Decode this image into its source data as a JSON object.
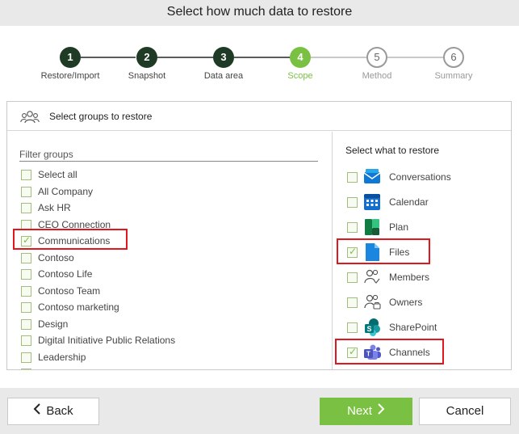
{
  "header": {
    "title": "Select how much data to restore"
  },
  "steps": [
    {
      "num": "1",
      "label": "Restore/Import",
      "state": "done"
    },
    {
      "num": "2",
      "label": "Snapshot",
      "state": "done"
    },
    {
      "num": "3",
      "label": "Data area",
      "state": "done"
    },
    {
      "num": "4",
      "label": "Scope",
      "state": "active"
    },
    {
      "num": "5",
      "label": "Method",
      "state": "todo"
    },
    {
      "num": "6",
      "label": "Summary",
      "state": "todo"
    }
  ],
  "panel": {
    "title": "Select groups to restore",
    "filter_label": "Filter groups",
    "groups": [
      {
        "label": "Select all",
        "checked": false
      },
      {
        "label": "All Company",
        "checked": false
      },
      {
        "label": "Ask HR",
        "checked": false
      },
      {
        "label": "CEO Connection",
        "checked": false
      },
      {
        "label": "Communications",
        "checked": true
      },
      {
        "label": "Contoso",
        "checked": false
      },
      {
        "label": "Contoso Life",
        "checked": false
      },
      {
        "label": "Contoso Team",
        "checked": false
      },
      {
        "label": "Contoso marketing",
        "checked": false
      },
      {
        "label": "Design",
        "checked": false
      },
      {
        "label": "Digital Initiative Public Relations",
        "checked": false
      },
      {
        "label": "Leadership",
        "checked": false
      }
    ],
    "restore_title": "Select what to restore",
    "resources": [
      {
        "label": "Conversations",
        "icon": "outlook-mail-icon",
        "checked": false
      },
      {
        "label": "Calendar",
        "icon": "calendar-icon",
        "checked": false
      },
      {
        "label": "Plan",
        "icon": "planner-icon",
        "checked": false
      },
      {
        "label": "Files",
        "icon": "files-icon",
        "checked": true
      },
      {
        "label": "Members",
        "icon": "members-icon",
        "checked": false
      },
      {
        "label": "Owners",
        "icon": "owners-icon",
        "checked": false
      },
      {
        "label": "SharePoint",
        "icon": "sharepoint-icon",
        "checked": false
      },
      {
        "label": "Channels",
        "icon": "teams-icon",
        "checked": true
      }
    ]
  },
  "footer": {
    "back_label": "Back",
    "next_label": "Next",
    "cancel_label": "Cancel"
  },
  "colors": {
    "accent": "#7ac143",
    "dark_step": "#1f3a25",
    "highlight": "#e0181e"
  }
}
